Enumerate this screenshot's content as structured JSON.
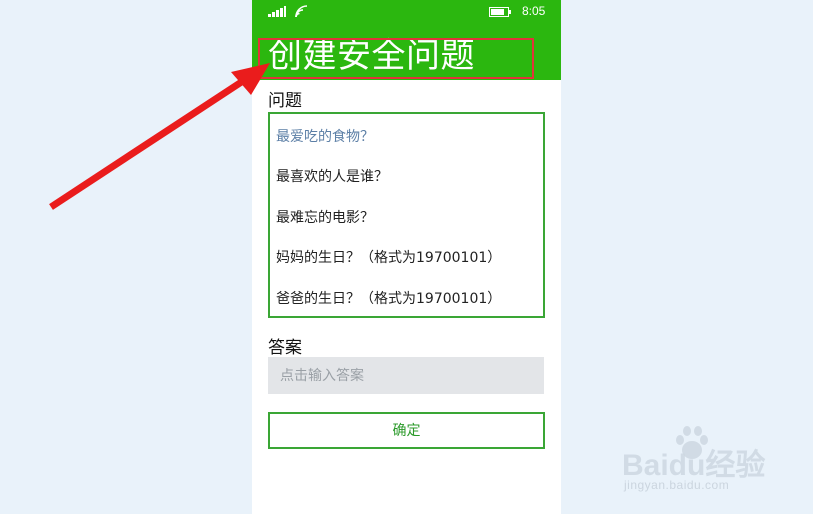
{
  "status_bar": {
    "time": "8:05"
  },
  "page": {
    "title": "创建安全问题"
  },
  "question_section": {
    "label": "问题",
    "options": [
      "最爱吃的食物？",
      "最喜欢的人是谁？",
      "最难忘的电影？",
      "妈妈的生日？（格式为19700101）",
      "爸爸的生日？（格式为19700101）"
    ]
  },
  "answer_section": {
    "label": "答案",
    "placeholder": "点击输入答案",
    "value": ""
  },
  "confirm_label": "确定",
  "watermark": {
    "brand": "Baidu经验",
    "url": "jingyan.baidu.com"
  },
  "colors": {
    "header": "#2bb70f",
    "accent": "#3aa635",
    "annotation": "#e0343a"
  },
  "annotation": {
    "type": "arrow",
    "color": "red"
  }
}
